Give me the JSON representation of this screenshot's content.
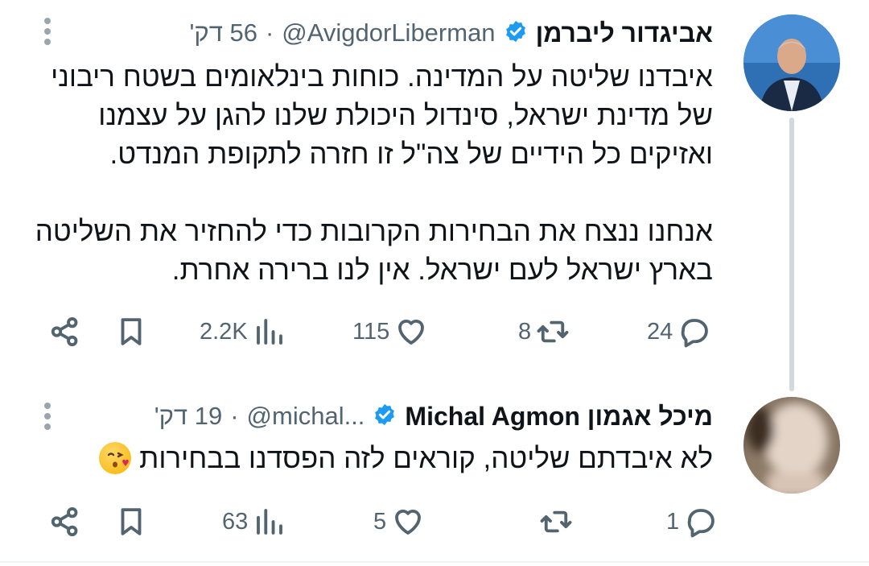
{
  "tweets": [
    {
      "author": {
        "display_name": "אביגדור ליברמן",
        "handle": "@AvigdorLiberman",
        "verified": true
      },
      "time": "56 דק'",
      "separator": "·",
      "body": "איבדנו שליטה על המדינה. כוחות בינלאומים בשטח ריבוני של מדינת ישראל, סינדול היכולת שלנו להגן על עצמנו ואזיקים כל הידיים של צה\"ל זו חזרה לתקופת המנדט.\n\nאנחנו ננצח את הבחירות הקרובות כדי להחזיר את השליטה בארץ ישראל לעם ישראל. אין לנו ברירה אחרת.",
      "stats": {
        "replies": "24",
        "retweets": "8",
        "likes": "115",
        "views": "2.2K"
      }
    },
    {
      "author": {
        "display_name": "מיכל אגמון Michal Agmon",
        "handle": "@michal...",
        "verified": true
      },
      "time": "19 דק'",
      "separator": "·",
      "body": "לא איבדתם שליטה, קוראים לזה הפסדנו בבחירות",
      "emoji": "face-blowing-kiss",
      "stats": {
        "replies": "1",
        "retweets": "",
        "likes": "5",
        "views": "63"
      }
    }
  ],
  "colors": {
    "verified": "#1d9bf0",
    "muted": "#536471",
    "thread_line": "#cfd9de"
  }
}
